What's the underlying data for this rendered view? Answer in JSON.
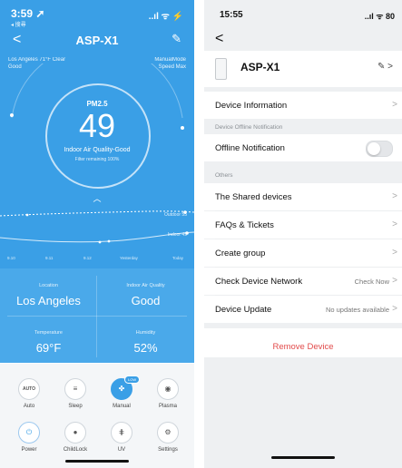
{
  "left": {
    "status": {
      "time": "3:59",
      "carrier": "◂ 搜尋",
      "icons": "..ıl ᯤ ⚡"
    },
    "header": {
      "back_icon": "chevron-left-icon",
      "title": "ASP-X1",
      "edit_icon": "pencil-icon"
    },
    "info_left": {
      "line1": "Los Angeles 71°F Clear",
      "line2": "Good"
    },
    "info_right": {
      "line1": "ManualMode",
      "line2": "Speed Max"
    },
    "gauge": {
      "label": "PM2.5",
      "value": "49",
      "quality": "Indoor Air Quality-Good",
      "filter": "Filter remaining 100%"
    },
    "chart": {
      "legend_outdoor": "Outdoor 55",
      "legend_indoor": "Indoor 49",
      "x_labels": [
        "9.10",
        "9.11",
        "9.12",
        "Yesterday",
        "Today"
      ]
    },
    "stats": {
      "location_caption": "Location",
      "location_value": "Los Angeles",
      "aq_caption": "Indoor Air Quality",
      "aq_value": "Good",
      "temp_caption": "Temperature",
      "temp_value": "69°F",
      "humidity_caption": "Humidity",
      "humidity_value": "52%"
    },
    "controls": {
      "auto": {
        "icon_text": "AUTO",
        "label": "Auto"
      },
      "sleep": {
        "label": "Sleep"
      },
      "manual": {
        "label": "Manual",
        "badge": "LOW"
      },
      "plasma": {
        "label": "Plasma"
      },
      "power": {
        "label": "Power"
      },
      "childlock": {
        "label": "ChildLock"
      },
      "uv": {
        "label": "UV"
      },
      "settings": {
        "label": "Settings"
      }
    },
    "colors": {
      "primary": "#3a9fe6"
    }
  },
  "right": {
    "status": {
      "time": "15:55",
      "icons": "..ıl ᯤ 80"
    },
    "device": {
      "name": "ASP-X1"
    },
    "rows": {
      "device_information": "Device Information",
      "offline_section": "Device Offline Notification",
      "offline_notification": "Offline Notification",
      "others_section": "Others",
      "shared_devices": "The Shared devices",
      "faqs": "FAQs & Tickets",
      "create_group": "Create group",
      "check_network": "Check Device Network",
      "check_now": "Check Now",
      "device_update": "Device Update",
      "no_updates": "No updates available",
      "remove_device": "Remove Device"
    },
    "colors": {
      "danger": "#e24b4b"
    }
  }
}
